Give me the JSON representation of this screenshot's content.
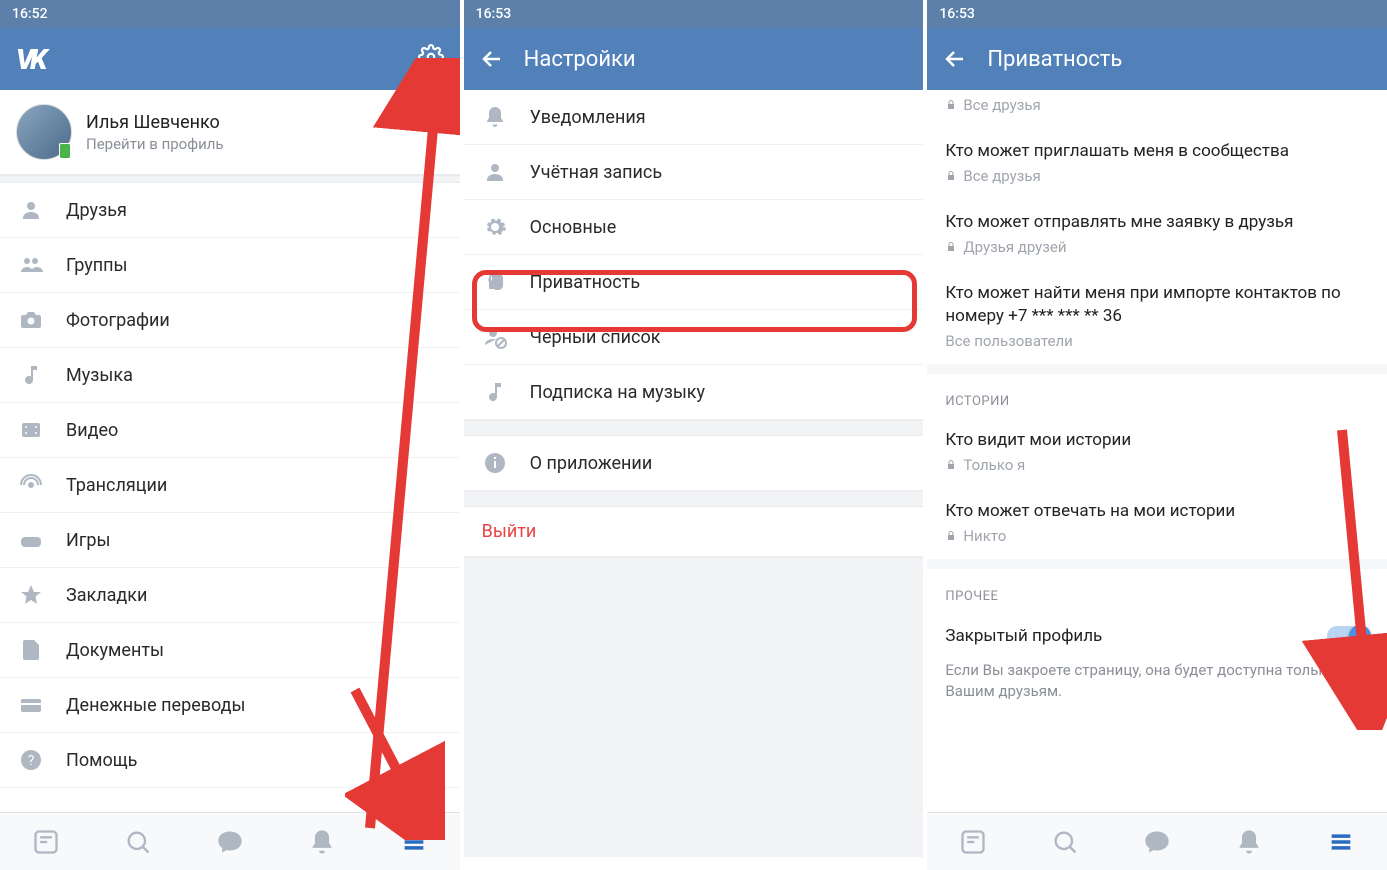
{
  "statusBar": {
    "time1": "16:52",
    "time2": "16:53",
    "time3": "16:53"
  },
  "screen1": {
    "profile": {
      "name": "Илья Шевченко",
      "subtitle": "Перейти в профиль"
    },
    "menu": [
      {
        "id": "friends",
        "label": "Друзья"
      },
      {
        "id": "groups",
        "label": "Группы"
      },
      {
        "id": "photos",
        "label": "Фотографии"
      },
      {
        "id": "music",
        "label": "Музыка"
      },
      {
        "id": "video",
        "label": "Видео"
      },
      {
        "id": "live",
        "label": "Трансляции"
      },
      {
        "id": "games",
        "label": "Игры"
      },
      {
        "id": "bookmarks",
        "label": "Закладки"
      },
      {
        "id": "docs",
        "label": "Документы"
      },
      {
        "id": "money",
        "label": "Денежные переводы"
      },
      {
        "id": "help",
        "label": "Помощь"
      }
    ]
  },
  "screen2": {
    "title": "Настройки",
    "items": [
      {
        "id": "notifications",
        "label": "Уведомления"
      },
      {
        "id": "account",
        "label": "Учётная запись"
      },
      {
        "id": "general",
        "label": "Основные"
      },
      {
        "id": "privacy",
        "label": "Приватность"
      },
      {
        "id": "blacklist",
        "label": "Чёрный список"
      },
      {
        "id": "music-sub",
        "label": "Подписка на музыку"
      }
    ],
    "about": "О приложении",
    "logout": "Выйти"
  },
  "screen3": {
    "title": "Приватность",
    "topValue": "Все друзья",
    "rows": [
      {
        "title": "Кто может приглашать меня в сообщества",
        "value": "Все друзья",
        "locked": true
      },
      {
        "title": "Кто может отправлять мне заявку в друзья",
        "value": "Друзья друзей",
        "locked": true
      },
      {
        "title": "Кто может найти меня при импорте контактов по номеру +7 *** *** ** 36",
        "value": "Все пользователи",
        "locked": false
      }
    ],
    "storiesHeader": "ИСТОРИИ",
    "storyRows": [
      {
        "title": "Кто видит мои истории",
        "value": "Только я",
        "locked": true
      },
      {
        "title": "Кто может отвечать на мои истории",
        "value": "Никто",
        "locked": true
      }
    ],
    "otherHeader": "ПРОЧЕЕ",
    "closedProfile": "Закрытый профиль",
    "closedDesc": "Если Вы закроете страницу, она будет доступна только Вашим друзьям."
  }
}
